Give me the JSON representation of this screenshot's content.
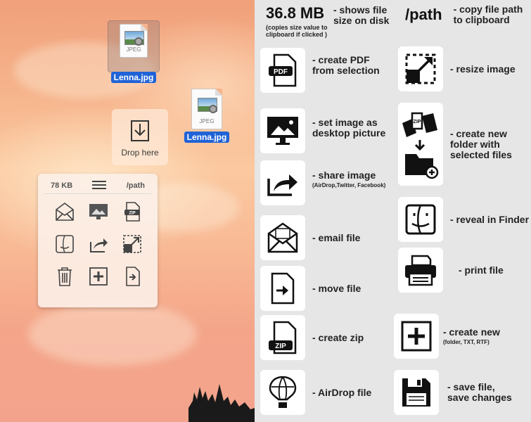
{
  "desktop": {
    "file1_name": "Lenna.jpg",
    "file2_name": "Lenna.jpg",
    "file_type": "JPEG",
    "dropzone_label": "Drop here",
    "panel": {
      "size": "78 KB",
      "path": "/path"
    }
  },
  "legend": {
    "size_value": "36.8 MB",
    "size_desc": "- shows file size on disk",
    "size_note": "(copies size value to clipboard if clicked )",
    "path_value": "/path",
    "path_desc": "- copy file path to clipboard",
    "pdf": "- create PDF from selection",
    "pdf_tag": "PDF",
    "resize": "- resize image",
    "desktop": "- set image as desktop picture",
    "newfolder": "- create new folder with selected files",
    "share": "- share image",
    "share_note": "(AirDrop,Twitter, Facebook)",
    "finder": "- reveal in Finder",
    "email": "- email file",
    "print": "- print file",
    "move": "- move file",
    "zip": "- create zip",
    "zip_tag": "ZIP",
    "createnew": "- create new",
    "createnew_note": "(folder, TXT, RTF)",
    "airdrop": "- AirDrop file",
    "save": "- save file, save changes"
  }
}
